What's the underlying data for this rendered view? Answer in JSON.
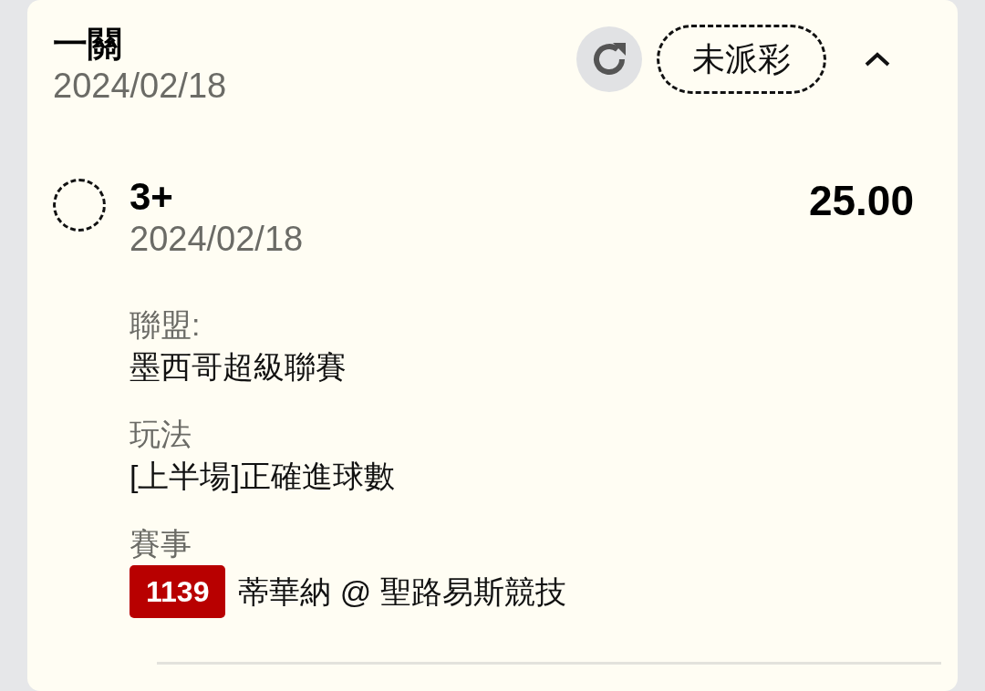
{
  "header": {
    "title": "一關",
    "date": "2024/02/18",
    "status": "未派彩",
    "expanded": true
  },
  "selection": {
    "pick": "3+",
    "date": "2024/02/18",
    "odds": "25.00",
    "selected": false,
    "details": [
      {
        "label": "聯盟:",
        "value": "墨西哥超級聯賽"
      },
      {
        "label": "玩法",
        "value": "[上半場]正確進球數"
      },
      {
        "label": "賽事",
        "match_no": "1139",
        "value": "蒂華納 @ 聖路易斯競技"
      }
    ]
  }
}
